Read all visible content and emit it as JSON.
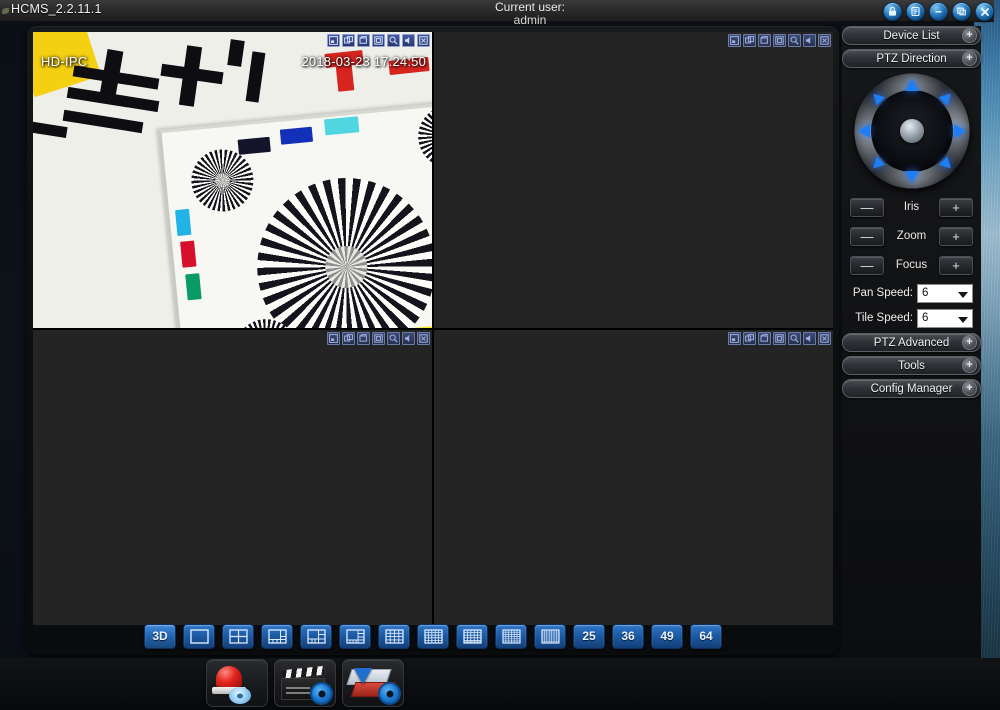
{
  "window": {
    "title": "HCMS_2.2.11.1",
    "current_user_label": "Current user:",
    "current_user_value": "admin",
    "buttons": [
      {
        "name": "lock-button",
        "icon": "lock-icon",
        "title": "Lock"
      },
      {
        "name": "log-button",
        "icon": "list-icon",
        "title": "Log"
      },
      {
        "name": "minimize-button",
        "icon": "minimize-icon",
        "title": "Minimize"
      },
      {
        "name": "maximize-button",
        "icon": "maximize-icon",
        "title": "Maximize"
      },
      {
        "name": "close-button",
        "icon": "close-icon",
        "title": "Close"
      }
    ]
  },
  "video": {
    "panes": [
      {
        "id": "pane-1",
        "active": true,
        "has_stream": true,
        "osd_name": "HD-IPC",
        "osd_timestamp": "2018-03-23 17:24:50"
      },
      {
        "id": "pane-2",
        "active": false,
        "has_stream": false,
        "osd_name": "",
        "osd_timestamp": ""
      },
      {
        "id": "pane-3",
        "active": false,
        "has_stream": false,
        "osd_name": "",
        "osd_timestamp": ""
      },
      {
        "id": "pane-4",
        "active": false,
        "has_stream": false,
        "osd_name": "",
        "osd_timestamp": ""
      }
    ],
    "pane_toolbar_icons": [
      "snapshot-icon",
      "multi-window-icon",
      "record-icon",
      "save-icon",
      "zoom-search-icon",
      "audio-icon",
      "close-stream-icon"
    ]
  },
  "layout_bar": {
    "buttons": [
      {
        "name": "layout-3d-button",
        "label": "3D",
        "type": "text"
      },
      {
        "name": "layout-1-button",
        "label": "1",
        "type": "grid",
        "cols": 1,
        "rows": 1
      },
      {
        "name": "layout-4-button",
        "label": "4",
        "type": "grid",
        "cols": 2,
        "rows": 2
      },
      {
        "name": "layout-6-button",
        "label": "6",
        "type": "grid",
        "cols": 3,
        "rows": 3
      },
      {
        "name": "layout-8-button",
        "label": "8",
        "type": "grid",
        "cols": 3,
        "rows": 3
      },
      {
        "name": "layout-9-button",
        "label": "9",
        "type": "grid",
        "cols": 4,
        "rows": 4
      },
      {
        "name": "layout-13-button",
        "label": "13",
        "type": "grid",
        "cols": 4,
        "rows": 4
      },
      {
        "name": "layout-16-button",
        "label": "16",
        "type": "grid",
        "cols": 4,
        "rows": 4
      },
      {
        "name": "layout-20-button",
        "label": "20",
        "type": "grid",
        "cols": 5,
        "rows": 5
      },
      {
        "name": "layout-24-button",
        "label": "24",
        "type": "grid",
        "cols": 5,
        "rows": 5
      },
      {
        "name": "layout-28-button",
        "label": "28",
        "type": "grid",
        "cols": 6,
        "rows": 6
      },
      {
        "name": "layout-25-button",
        "label": "25",
        "type": "text"
      },
      {
        "name": "layout-36-button",
        "label": "36",
        "type": "text"
      },
      {
        "name": "layout-49-button",
        "label": "49",
        "type": "text"
      },
      {
        "name": "layout-64-button",
        "label": "64",
        "type": "text"
      }
    ]
  },
  "sidebar": {
    "device_list": {
      "label": "Device List",
      "expand": "+"
    },
    "ptz_direction": {
      "label": "PTZ Direction",
      "expand": "+"
    },
    "ptz_arrows": [
      "up",
      "down",
      "left",
      "right",
      "up-left",
      "up-right",
      "down-left",
      "down-right"
    ],
    "lens_controls": [
      {
        "name": "iris",
        "label": "Iris",
        "minus": "—",
        "plus": "+"
      },
      {
        "name": "zoom",
        "label": "Zoom",
        "minus": "—",
        "plus": "+"
      },
      {
        "name": "focus",
        "label": "Focus",
        "minus": "—",
        "plus": "+"
      }
    ],
    "speeds": [
      {
        "name": "pan-speed",
        "label": "Pan Speed:",
        "value": "6"
      },
      {
        "name": "tile-speed",
        "label": "Tile Speed:",
        "value": "6"
      }
    ],
    "sections": [
      {
        "name": "ptz-advanced",
        "label": "PTZ Advanced",
        "expand": "+"
      },
      {
        "name": "tools",
        "label": "Tools",
        "expand": "+"
      },
      {
        "name": "config-manager",
        "label": "Config Manager",
        "expand": "+"
      }
    ]
  },
  "dock": {
    "items": [
      {
        "name": "alarm-icon",
        "title": "Alarm"
      },
      {
        "name": "playback-icon",
        "title": "Playback"
      },
      {
        "name": "backup-icon",
        "title": "Backup"
      }
    ]
  },
  "colors": {
    "accent_blue": "#1e7ef5",
    "button_blue": "#2f76c8",
    "active_pane_border": "#1f6b1f",
    "panel_bg": "#242424",
    "titlebar_bg": "#2b2b2b"
  }
}
